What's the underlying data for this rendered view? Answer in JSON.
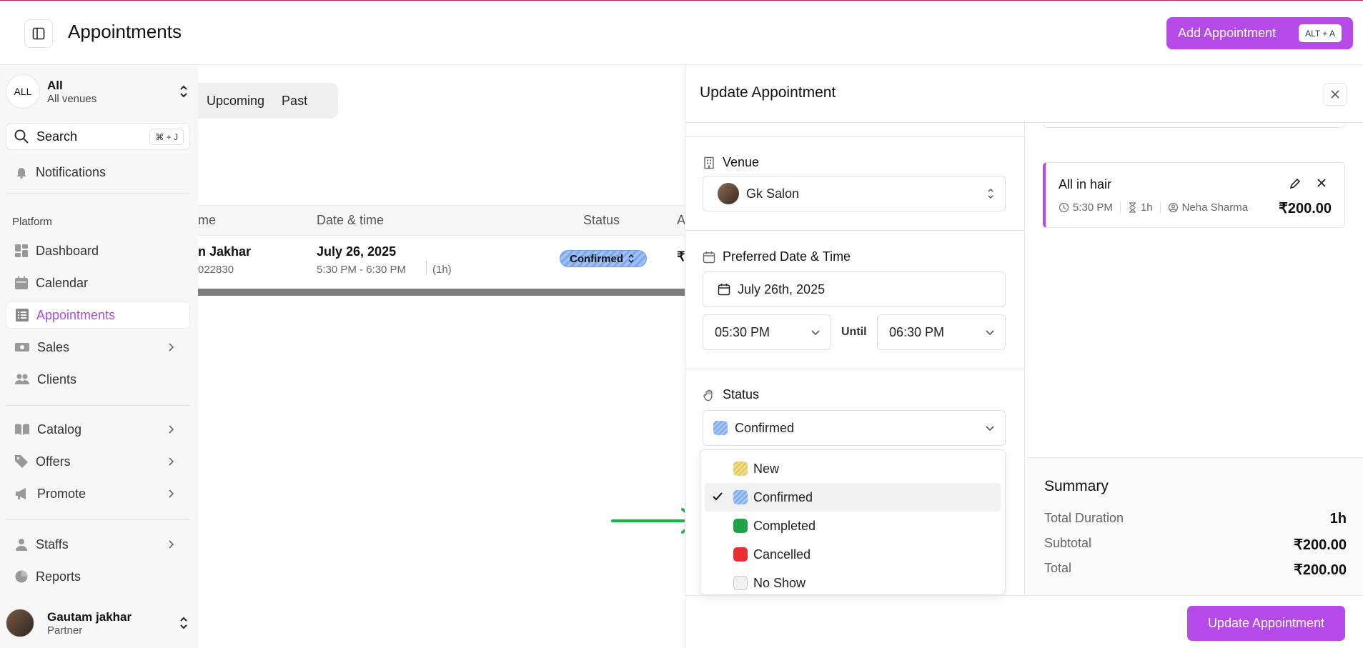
{
  "header": {
    "title": "Appointments",
    "add_button": "Add Appointment",
    "add_shortcut": "ALT + A"
  },
  "sidebar": {
    "venue_badge": "ALL",
    "venue_title": "All",
    "venue_subtitle": "All venues",
    "search_label": "Search",
    "search_shortcut": "⌘ + J",
    "notifications": "Notifications",
    "section_platform": "Platform",
    "items": [
      {
        "label": "Dashboard"
      },
      {
        "label": "Calendar"
      },
      {
        "label": "Appointments"
      },
      {
        "label": "Sales"
      },
      {
        "label": "Clients"
      },
      {
        "label": "Catalog"
      },
      {
        "label": "Offers"
      },
      {
        "label": "Promote"
      },
      {
        "label": "Staffs"
      },
      {
        "label": "Reports"
      }
    ],
    "user_name": "Gautam jakhar",
    "user_role": "Partner"
  },
  "main": {
    "tabs": [
      "Upcoming",
      "Past"
    ],
    "columns": [
      "me",
      "Date & time",
      "Status",
      "A"
    ],
    "row": {
      "name": "n Jakhar",
      "phone": "022830",
      "date": "July 26, 2025",
      "time": "5:30 PM - 6:30 PM",
      "duration": "(1h)",
      "status": "Confirmed",
      "amount_prefix": "₹"
    }
  },
  "panel": {
    "title": "Update Appointment",
    "venue_label": "Venue",
    "venue_value": "Gk Salon",
    "datetime_label": "Preferred Date & Time",
    "date_value": "July 26th, 2025",
    "start_time": "05:30 PM",
    "until_label": "Until",
    "end_time": "06:30 PM",
    "status_label": "Status",
    "status_value": "Confirmed",
    "status_options": [
      {
        "label": "New",
        "color": "#e8d36f"
      },
      {
        "label": "Confirmed",
        "color": "#8db4f2",
        "selected": true
      },
      {
        "label": "Completed",
        "color": "#1fa24a"
      },
      {
        "label": "Cancelled",
        "color": "#ec2d2d"
      },
      {
        "label": "No Show",
        "color": "#f1f1f1"
      }
    ],
    "service": {
      "name": "All in hair",
      "time": "5:30 PM",
      "duration": "1h",
      "staff": "Neha Sharma",
      "price": "₹200.00"
    },
    "summary": {
      "title": "Summary",
      "total_duration_label": "Total Duration",
      "total_duration_value": "1h",
      "subtotal_label": "Subtotal",
      "subtotal_value": "₹200.00",
      "total_label": "Total",
      "total_value": "₹200.00"
    },
    "submit": "Update Appointment"
  },
  "colors": {
    "accent": "#b54ae8",
    "confirmed": "#8db4f2",
    "arrow": "#19b34a"
  }
}
